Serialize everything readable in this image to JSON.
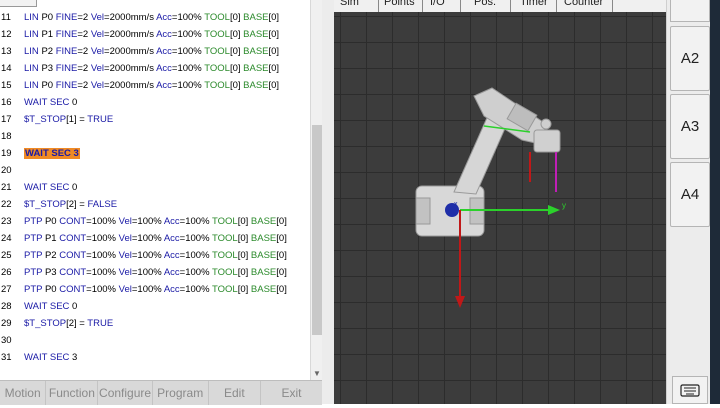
{
  "code": {
    "lines": [
      {
        "n": "11",
        "parts": [
          {
            "c": "kw",
            "t": "LIN "
          },
          {
            "c": "num",
            "t": "P0 "
          },
          {
            "c": "kw",
            "t": "FINE"
          },
          {
            "c": "num",
            "t": "=2 "
          },
          {
            "c": "kw",
            "t": "Vel"
          },
          {
            "c": "num",
            "t": "=2000mm/s "
          },
          {
            "c": "kw",
            "t": "Acc"
          },
          {
            "c": "num",
            "t": "=100% "
          },
          {
            "c": "grn",
            "t": "TOOL"
          },
          {
            "c": "num",
            "t": "[0] "
          },
          {
            "c": "grn",
            "t": "BASE"
          },
          {
            "c": "num",
            "t": "[0]"
          }
        ]
      },
      {
        "n": "12",
        "parts": [
          {
            "c": "kw",
            "t": "LIN "
          },
          {
            "c": "num",
            "t": "P1 "
          },
          {
            "c": "kw",
            "t": "FINE"
          },
          {
            "c": "num",
            "t": "=2 "
          },
          {
            "c": "kw",
            "t": "Vel"
          },
          {
            "c": "num",
            "t": "=2000mm/s "
          },
          {
            "c": "kw",
            "t": "Acc"
          },
          {
            "c": "num",
            "t": "=100% "
          },
          {
            "c": "grn",
            "t": "TOOL"
          },
          {
            "c": "num",
            "t": "[0] "
          },
          {
            "c": "grn",
            "t": "BASE"
          },
          {
            "c": "num",
            "t": "[0]"
          }
        ]
      },
      {
        "n": "13",
        "parts": [
          {
            "c": "kw",
            "t": "LIN "
          },
          {
            "c": "num",
            "t": "P2 "
          },
          {
            "c": "kw",
            "t": "FINE"
          },
          {
            "c": "num",
            "t": "=2 "
          },
          {
            "c": "kw",
            "t": "Vel"
          },
          {
            "c": "num",
            "t": "=2000mm/s "
          },
          {
            "c": "kw",
            "t": "Acc"
          },
          {
            "c": "num",
            "t": "=100% "
          },
          {
            "c": "grn",
            "t": "TOOL"
          },
          {
            "c": "num",
            "t": "[0] "
          },
          {
            "c": "grn",
            "t": "BASE"
          },
          {
            "c": "num",
            "t": "[0]"
          }
        ]
      },
      {
        "n": "14",
        "parts": [
          {
            "c": "kw",
            "t": "LIN "
          },
          {
            "c": "num",
            "t": "P3 "
          },
          {
            "c": "kw",
            "t": "FINE"
          },
          {
            "c": "num",
            "t": "=2 "
          },
          {
            "c": "kw",
            "t": "Vel"
          },
          {
            "c": "num",
            "t": "=2000mm/s "
          },
          {
            "c": "kw",
            "t": "Acc"
          },
          {
            "c": "num",
            "t": "=100% "
          },
          {
            "c": "grn",
            "t": "TOOL"
          },
          {
            "c": "num",
            "t": "[0] "
          },
          {
            "c": "grn",
            "t": "BASE"
          },
          {
            "c": "num",
            "t": "[0]"
          }
        ]
      },
      {
        "n": "15",
        "parts": [
          {
            "c": "kw",
            "t": "LIN "
          },
          {
            "c": "num",
            "t": "P0 "
          },
          {
            "c": "kw",
            "t": "FINE"
          },
          {
            "c": "num",
            "t": "=2 "
          },
          {
            "c": "kw",
            "t": "Vel"
          },
          {
            "c": "num",
            "t": "=2000mm/s "
          },
          {
            "c": "kw",
            "t": "Acc"
          },
          {
            "c": "num",
            "t": "=100% "
          },
          {
            "c": "grn",
            "t": "TOOL"
          },
          {
            "c": "num",
            "t": "[0] "
          },
          {
            "c": "grn",
            "t": "BASE"
          },
          {
            "c": "num",
            "t": "[0]"
          }
        ]
      },
      {
        "n": "16",
        "parts": [
          {
            "c": "kw",
            "t": "WAIT SEC "
          },
          {
            "c": "num",
            "t": "0"
          }
        ]
      },
      {
        "n": "17",
        "parts": [
          {
            "c": "kw",
            "t": "$T_STOP"
          },
          {
            "c": "num",
            "t": "[1] = "
          },
          {
            "c": "kw",
            "t": "TRUE"
          }
        ]
      },
      {
        "n": "18",
        "parts": []
      },
      {
        "n": "19",
        "parts": [
          {
            "c": "hl",
            "t": "WAIT SEC 3"
          }
        ]
      },
      {
        "n": "20",
        "parts": []
      },
      {
        "n": "21",
        "parts": [
          {
            "c": "kw",
            "t": "WAIT SEC "
          },
          {
            "c": "num",
            "t": "0"
          }
        ]
      },
      {
        "n": "22",
        "parts": [
          {
            "c": "kw",
            "t": "$T_STOP"
          },
          {
            "c": "num",
            "t": "[2] = "
          },
          {
            "c": "kw",
            "t": "FALSE"
          }
        ]
      },
      {
        "n": "23",
        "parts": [
          {
            "c": "kw",
            "t": "PTP "
          },
          {
            "c": "num",
            "t": "P0 "
          },
          {
            "c": "kw",
            "t": "CONT"
          },
          {
            "c": "num",
            "t": "=100% "
          },
          {
            "c": "kw",
            "t": "Vel"
          },
          {
            "c": "num",
            "t": "=100% "
          },
          {
            "c": "kw",
            "t": "Acc"
          },
          {
            "c": "num",
            "t": "=100% "
          },
          {
            "c": "grn",
            "t": "TOOL"
          },
          {
            "c": "num",
            "t": "[0] "
          },
          {
            "c": "grn",
            "t": "BASE"
          },
          {
            "c": "num",
            "t": "[0]"
          }
        ]
      },
      {
        "n": "24",
        "parts": [
          {
            "c": "kw",
            "t": "PTP "
          },
          {
            "c": "num",
            "t": "P1 "
          },
          {
            "c": "kw",
            "t": "CONT"
          },
          {
            "c": "num",
            "t": "=100% "
          },
          {
            "c": "kw",
            "t": "Vel"
          },
          {
            "c": "num",
            "t": "=100% "
          },
          {
            "c": "kw",
            "t": "Acc"
          },
          {
            "c": "num",
            "t": "=100% "
          },
          {
            "c": "grn",
            "t": "TOOL"
          },
          {
            "c": "num",
            "t": "[0] "
          },
          {
            "c": "grn",
            "t": "BASE"
          },
          {
            "c": "num",
            "t": "[0]"
          }
        ]
      },
      {
        "n": "25",
        "parts": [
          {
            "c": "kw",
            "t": "PTP "
          },
          {
            "c": "num",
            "t": "P2 "
          },
          {
            "c": "kw",
            "t": "CONT"
          },
          {
            "c": "num",
            "t": "=100% "
          },
          {
            "c": "kw",
            "t": "Vel"
          },
          {
            "c": "num",
            "t": "=100% "
          },
          {
            "c": "kw",
            "t": "Acc"
          },
          {
            "c": "num",
            "t": "=100% "
          },
          {
            "c": "grn",
            "t": "TOOL"
          },
          {
            "c": "num",
            "t": "[0] "
          },
          {
            "c": "grn",
            "t": "BASE"
          },
          {
            "c": "num",
            "t": "[0]"
          }
        ]
      },
      {
        "n": "26",
        "parts": [
          {
            "c": "kw",
            "t": "PTP "
          },
          {
            "c": "num",
            "t": "P3 "
          },
          {
            "c": "kw",
            "t": "CONT"
          },
          {
            "c": "num",
            "t": "=100% "
          },
          {
            "c": "kw",
            "t": "Vel"
          },
          {
            "c": "num",
            "t": "=100% "
          },
          {
            "c": "kw",
            "t": "Acc"
          },
          {
            "c": "num",
            "t": "=100% "
          },
          {
            "c": "grn",
            "t": "TOOL"
          },
          {
            "c": "num",
            "t": "[0] "
          },
          {
            "c": "grn",
            "t": "BASE"
          },
          {
            "c": "num",
            "t": "[0]"
          }
        ]
      },
      {
        "n": "27",
        "parts": [
          {
            "c": "kw",
            "t": "PTP "
          },
          {
            "c": "num",
            "t": "P0 "
          },
          {
            "c": "kw",
            "t": "CONT"
          },
          {
            "c": "num",
            "t": "=100% "
          },
          {
            "c": "kw",
            "t": "Vel"
          },
          {
            "c": "num",
            "t": "=100% "
          },
          {
            "c": "kw",
            "t": "Acc"
          },
          {
            "c": "num",
            "t": "=100% "
          },
          {
            "c": "grn",
            "t": "TOOL"
          },
          {
            "c": "num",
            "t": "[0] "
          },
          {
            "c": "grn",
            "t": "BASE"
          },
          {
            "c": "num",
            "t": "[0]"
          }
        ]
      },
      {
        "n": "28",
        "parts": [
          {
            "c": "kw",
            "t": "WAIT SEC "
          },
          {
            "c": "num",
            "t": "0"
          }
        ]
      },
      {
        "n": "29",
        "parts": [
          {
            "c": "kw",
            "t": "$T_STOP"
          },
          {
            "c": "num",
            "t": "[2] = "
          },
          {
            "c": "kw",
            "t": "TRUE"
          }
        ]
      },
      {
        "n": "30",
        "parts": []
      },
      {
        "n": "31",
        "parts": [
          {
            "c": "kw",
            "t": "WAIT SEC "
          },
          {
            "c": "num",
            "t": "3"
          }
        ]
      }
    ]
  },
  "menu": {
    "items": [
      "Motion",
      "Function",
      "Configure",
      "Program",
      "Edit",
      "Exit"
    ]
  },
  "tabs": {
    "items": [
      "Sim",
      "Points",
      "I/O",
      "Pos.",
      "Timer",
      "Counter"
    ]
  },
  "side": {
    "buttons": [
      "A2",
      "A3",
      "A4"
    ]
  },
  "colors": {
    "highlight": "#f08a24",
    "keyword": "#1a1aa6",
    "green": "#2b8a2b"
  },
  "icons": {
    "keyboard": "keyboard-icon",
    "scroll": "scroll-down-arrow-icon"
  }
}
